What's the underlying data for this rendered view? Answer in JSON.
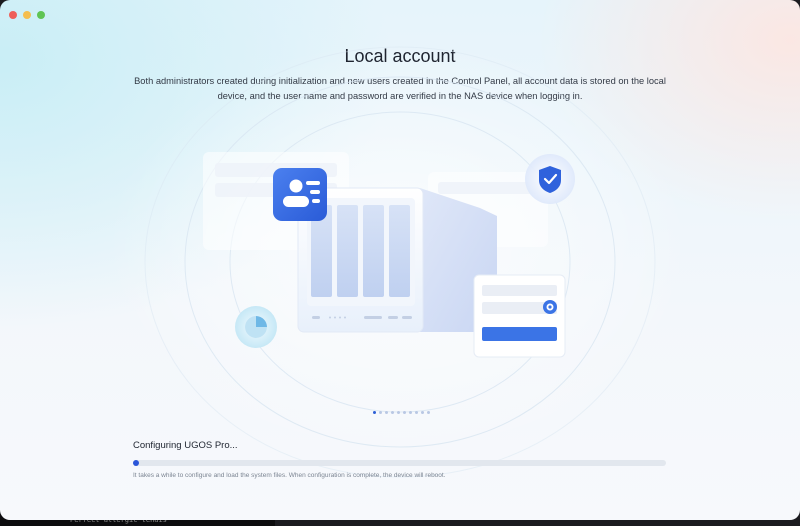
{
  "window": {
    "title": "Local account",
    "description": "Both administrators created during initialization and new users created in the Control Panel, all account data is stored on the local device, and the user name and password are verified in the NAS device when logging in."
  },
  "carousel": {
    "total": 10,
    "active": 0
  },
  "progress": {
    "title": "Configuring UGOS Pro...",
    "note": "It takes a while to configure and load the system files. When configuration is complete, the device will reboot.",
    "value": 0.01
  },
  "terminal": {
    "text": "Perfect allergic tenais"
  },
  "icons": [
    "user-card-icon",
    "shield-check-icon",
    "pie-chart-icon",
    "eye-icon",
    "nas-device-icon"
  ],
  "colors": {
    "accent": "#2b56d9",
    "login_button": "#3b74e6"
  }
}
